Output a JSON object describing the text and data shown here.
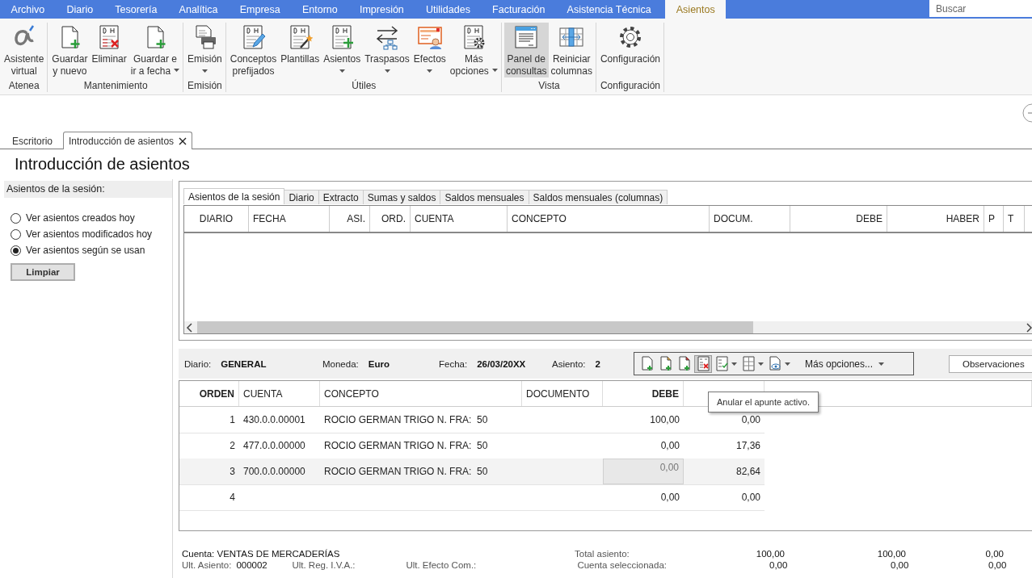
{
  "menu": {
    "items": [
      {
        "label": "Archivo",
        "selected": false
      },
      {
        "label": "Diario",
        "selected": false
      },
      {
        "label": "Tesorería",
        "selected": false
      },
      {
        "label": "Analítica",
        "selected": false
      },
      {
        "label": "Empresa",
        "selected": false
      },
      {
        "label": "Entorno",
        "selected": false
      },
      {
        "label": "Impresión",
        "selected": false
      },
      {
        "label": "Utilidades",
        "selected": false
      },
      {
        "label": "Facturación",
        "selected": false
      },
      {
        "label": "Asistencia Técnica",
        "selected": false
      },
      {
        "label": "Asientos",
        "selected": true
      }
    ],
    "search": {
      "placeholder": "Buscar"
    }
  },
  "ribbon": {
    "groups": [
      {
        "label": "Atenea",
        "buttons": [
          {
            "label": "Asistente\nvirtual",
            "dropdown": false,
            "pressed": false
          }
        ]
      },
      {
        "label": "Mantenimiento",
        "buttons": [
          {
            "label": "Guardar\ny nuevo",
            "dropdown": false,
            "pressed": false
          },
          {
            "label": "Eliminar",
            "dropdown": false,
            "pressed": false
          },
          {
            "label": "Guardar e\nir a fecha",
            "dropdown": true,
            "pressed": false
          }
        ]
      },
      {
        "label": "Emisión",
        "buttons": [
          {
            "label": "Emisión",
            "dropdown": true,
            "pressed": false
          }
        ]
      },
      {
        "label": "Útiles",
        "buttons": [
          {
            "label": "Conceptos\nprefijados",
            "dropdown": false,
            "pressed": false
          },
          {
            "label": "Plantillas",
            "dropdown": false,
            "pressed": false
          },
          {
            "label": "Asientos",
            "dropdown": true,
            "pressed": false
          },
          {
            "label": "Traspasos",
            "dropdown": true,
            "pressed": false
          },
          {
            "label": "Efectos",
            "dropdown": true,
            "pressed": false
          },
          {
            "label": "Más\nopciones",
            "dropdown": true,
            "pressed": false
          }
        ]
      },
      {
        "label": "Vista",
        "buttons": [
          {
            "label": "Panel de\nconsultas",
            "dropdown": false,
            "pressed": true
          },
          {
            "label": "Reiniciar\ncolumnas",
            "dropdown": false,
            "pressed": false
          }
        ]
      },
      {
        "label": "Configuración",
        "buttons": [
          {
            "label": "Configuración",
            "dropdown": false,
            "pressed": false
          }
        ]
      }
    ]
  },
  "doc_tabs": [
    {
      "label": "Escritorio",
      "selected": false,
      "closable": false
    },
    {
      "label": "Introducción de asientos",
      "selected": true,
      "closable": true
    }
  ],
  "page_title": "Introducción de asientos",
  "session": {
    "title": "Asientos de la sesión:",
    "options": [
      {
        "label": "Ver asientos creados hoy",
        "selected": false
      },
      {
        "label": "Ver asientos modificados hoy",
        "selected": false
      },
      {
        "label": "Ver asientos según se usan",
        "selected": true
      }
    ],
    "button": "Limpiar"
  },
  "query": {
    "tabs": [
      {
        "label": "Asientos de la sesión",
        "selected": true
      },
      {
        "label": "Diario",
        "selected": false
      },
      {
        "label": "Extracto",
        "selected": false
      },
      {
        "label": "Sumas y saldos",
        "selected": false
      },
      {
        "label": "Saldos mensuales",
        "selected": false
      },
      {
        "label": "Saldos mensuales (columnas)",
        "selected": false
      }
    ],
    "columns": [
      "DIARIO",
      "FECHA",
      "ASI.",
      "ORD.",
      "CUENTA",
      "CONCEPTO",
      "DOCUM.",
      "DEBE",
      "HABER",
      "P",
      "T"
    ]
  },
  "entry_bar": {
    "fields": [
      {
        "label": "Diario:",
        "value": "GENERAL"
      },
      {
        "label": "Moneda:",
        "value": "Euro"
      },
      {
        "label": "Fecha:",
        "value": "26/03/20XX"
      },
      {
        "label": "Asiento:",
        "value": "2"
      }
    ],
    "toolbar": [
      {
        "hovered": false,
        "dropdown": false
      },
      {
        "hovered": false,
        "dropdown": false
      },
      {
        "hovered": false,
        "dropdown": false
      },
      {
        "hovered": true,
        "dropdown": false
      },
      {
        "hovered": false,
        "dropdown": true
      },
      {
        "hovered": false,
        "dropdown": true
      },
      {
        "hovered": false,
        "dropdown": true
      }
    ],
    "more_options": "Más opciones...",
    "observations": "Observaciones"
  },
  "entry_grid": {
    "columns": [
      {
        "label": "ORDEN",
        "required": true
      },
      {
        "label": "CUENTA",
        "required": false
      },
      {
        "label": "CONCEPTO",
        "required": false
      },
      {
        "label": "DOCUMENTO",
        "required": false
      },
      {
        "label": "DEBE",
        "required": true
      }
    ],
    "rows": [
      {
        "orden": "1",
        "cuenta": "430.0.0.00001",
        "concepto": "ROCIO GERMAN TRIGO N. FRA:  50",
        "debe": "100,00",
        "haber": "0,00",
        "selected": false
      },
      {
        "orden": "2",
        "cuenta": "477.0.0.00000",
        "concepto": "ROCIO GERMAN TRIGO N. FRA:  50",
        "debe": "0,00",
        "haber": "17,36",
        "selected": false
      },
      {
        "orden": "3",
        "cuenta": "700.0.0.00000",
        "concepto": "ROCIO GERMAN TRIGO N. FRA:  50",
        "debe": "0,00",
        "haber": "82,64",
        "selected": true
      },
      {
        "orden": "4",
        "debe": "0,00",
        "haber": "0,00",
        "selected": false
      }
    ]
  },
  "tooltip": "Anular el apunte activo.",
  "footer": {
    "account": "Cuenta: VENTAS DE MERCADERÍAS",
    "fields": [
      {
        "label": "Ult. Asiento:",
        "value": "000002"
      },
      {
        "label": "Ult. Reg. I.V.A.:"
      },
      {
        "label": "Ult. Efecto Com.:"
      }
    ],
    "totals": [
      {
        "label": "Total asiento:",
        "values": [
          "100,00",
          "100,00",
          "0,00"
        ]
      },
      {
        "label": "Cuenta seleccionada:",
        "values": [
          "0,00",
          "0,00",
          "0,00"
        ]
      }
    ]
  }
}
